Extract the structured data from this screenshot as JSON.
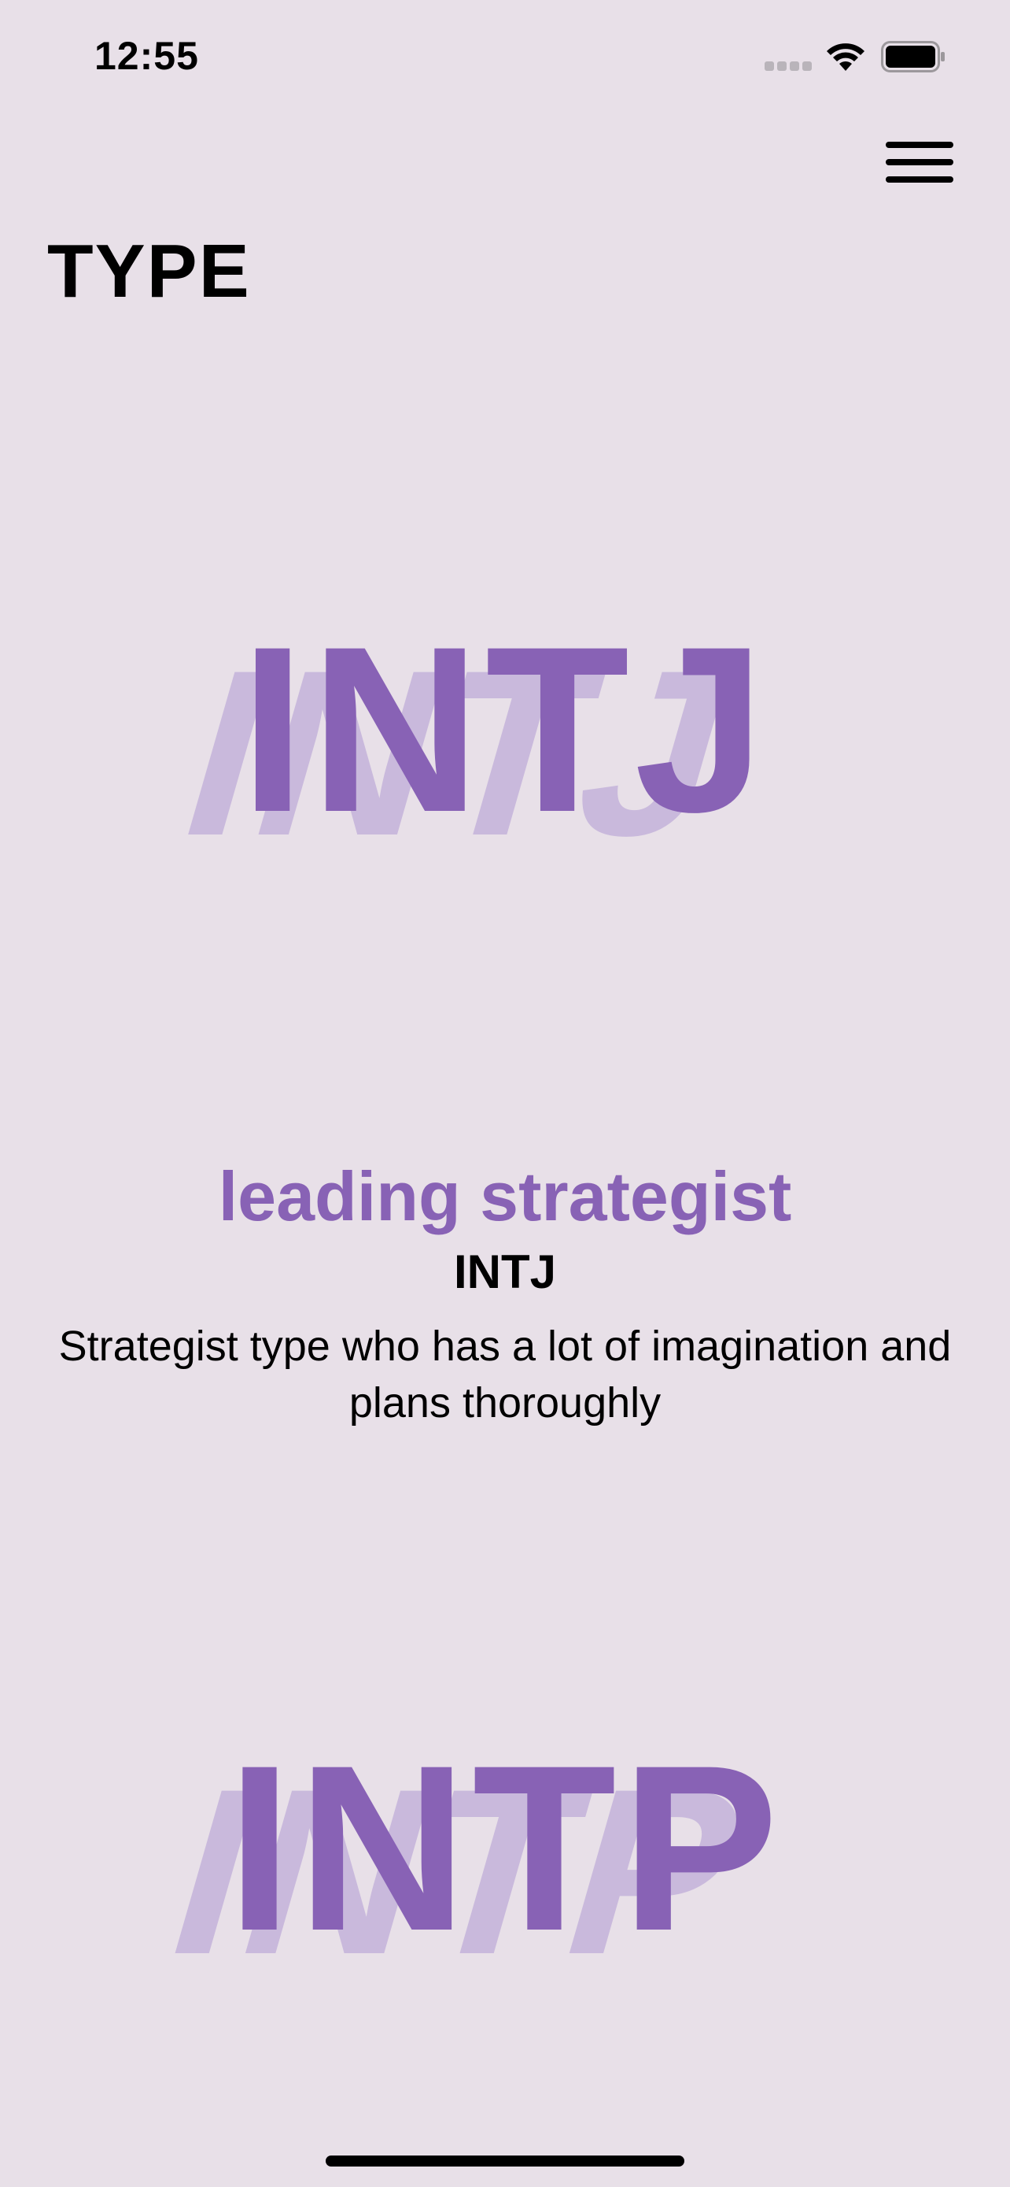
{
  "status_bar": {
    "time": "12:55",
    "signal_icon": "cellular-signal-icon",
    "wifi_icon": "wifi-icon",
    "battery_icon": "battery-icon"
  },
  "header": {
    "title": "TYPE",
    "menu_icon": "hamburger-menu-icon"
  },
  "types": [
    {
      "code": "INTJ",
      "nickname": "leading strategist",
      "description": "Strategist type who has a lot of imagination and plans thoroughly"
    },
    {
      "code": "INTP"
    }
  ],
  "colors": {
    "background": "#e8e0e8",
    "accent": "#8862b5",
    "accent_shadow": "#c9b9dc",
    "text": "#000000"
  }
}
